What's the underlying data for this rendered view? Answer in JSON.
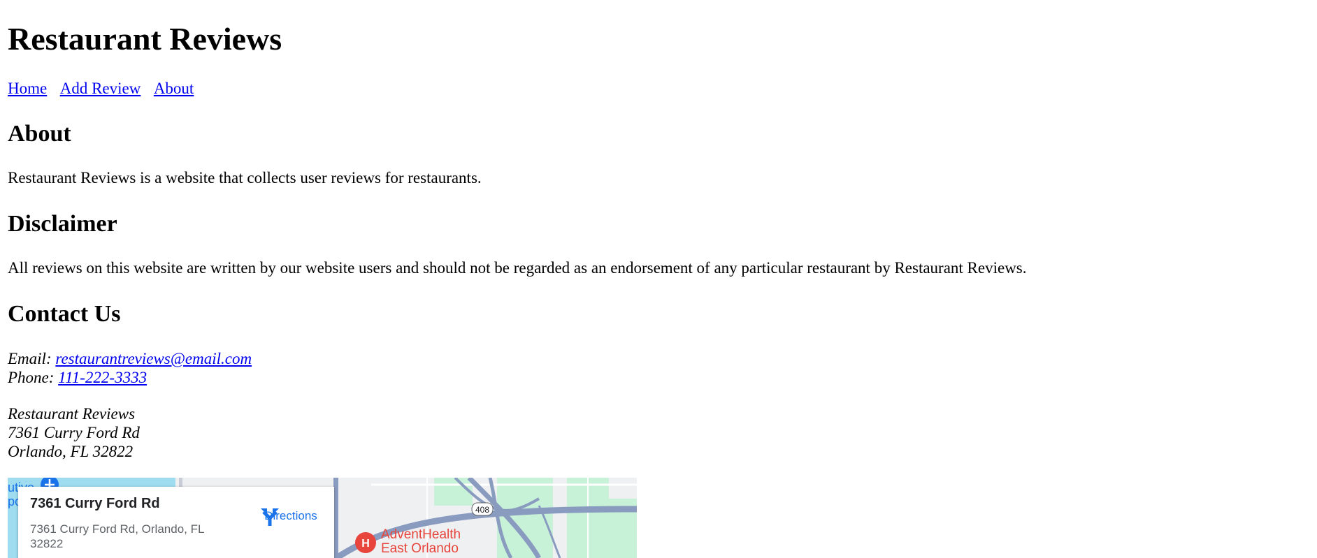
{
  "site": {
    "title": "Restaurant Reviews"
  },
  "nav": {
    "items": [
      "Home",
      "Add Review",
      "About"
    ]
  },
  "about": {
    "heading": "About",
    "text": "Restaurant Reviews is a website that collects user reviews for restaurants."
  },
  "disclaimer": {
    "heading": "Disclaimer",
    "text": "All reviews on this website are written by our website users and should not be regarded as an endorsement of any particular restaurant by Restaurant Reviews."
  },
  "contact": {
    "heading": "Contact Us",
    "email_label": "Email:",
    "email": "restaurantreviews@email.com",
    "phone_label": "Phone:",
    "phone": "111-222-3333",
    "address_lines": [
      "Restaurant Reviews",
      "7361 Curry Ford Rd",
      "Orlando, FL 32822"
    ]
  },
  "map": {
    "place_title": "7361 Curry Ford Rd",
    "place_address": "7361 Curry Ford Rd, Orlando, FL 32822",
    "directions_label": "Directions",
    "edge_text_1": "utive",
    "edge_text_2": "po",
    "route_shield": "408",
    "poi_label_line1": "AdventHealth",
    "poi_label_line2": "East Orlando",
    "poi_marker_letter": "H",
    "colors": {
      "water": "#9fdcf0",
      "green": "#c8f2d8",
      "highway": "#8a9bc0",
      "poi_red": "#e8453c",
      "link_blue": "#1a73e8"
    }
  }
}
